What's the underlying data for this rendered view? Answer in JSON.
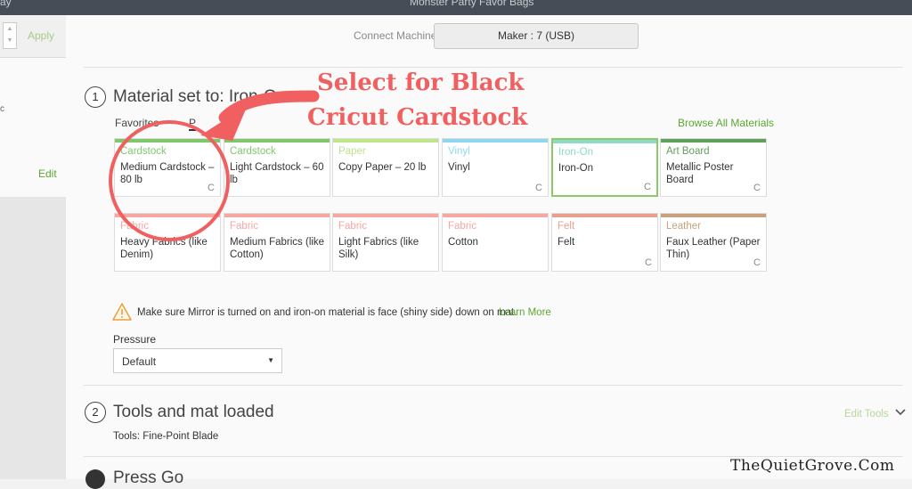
{
  "topbar": {
    "left_text": "ay",
    "center_text": "Monster Party Favor Bags"
  },
  "left_panel": {
    "apply_label": "Apply",
    "edit_label": "Edit",
    "stray_char": "c"
  },
  "header": {
    "connect_label": "Connect Machine",
    "machine": "Maker : 7 (USB)"
  },
  "step1": {
    "number": "1",
    "title": "Material set to: Iron-On",
    "tabs": [
      {
        "label": "Favorites"
      },
      {
        "label": "P"
      }
    ],
    "browse_label": "Browse All Materials",
    "materials": [
      {
        "category": "Cardstock",
        "name": "Medium Cardstock – 80 lb",
        "color": "#7ec86a",
        "badge": "C"
      },
      {
        "category": "Cardstock",
        "name": "Light Cardstock – 60 lb",
        "color": "#7ec86a",
        "badge": ""
      },
      {
        "category": "Paper",
        "name": "Copy Paper – 20 lb",
        "color": "#bfe48a",
        "badge": ""
      },
      {
        "category": "Vinyl",
        "name": "Vinyl",
        "color": "#8fd7ef",
        "badge": "C"
      },
      {
        "category": "Iron-On",
        "name": "Iron-On",
        "color": "#8ed9c8",
        "badge": "C",
        "selected": true
      },
      {
        "category": "Art Board",
        "name": "Metallic Poster Board",
        "color": "#5fa05a",
        "badge": "C"
      },
      {
        "category": "Fabric",
        "name": "Heavy Fabrics (like Denim)",
        "color": "#f5a7a0",
        "badge": ""
      },
      {
        "category": "Fabric",
        "name": "Medium Fabrics (like Cotton)",
        "color": "#f5a7a0",
        "badge": ""
      },
      {
        "category": "Fabric",
        "name": "Light Fabrics (like Silk)",
        "color": "#f5a7a0",
        "badge": ""
      },
      {
        "category": "Fabric",
        "name": "Cotton",
        "color": "#f5a7a0",
        "badge": ""
      },
      {
        "category": "Felt",
        "name": "Felt",
        "color": "#e8a08a",
        "badge": "C"
      },
      {
        "category": "Leather",
        "name": "Faux Leather (Paper Thin)",
        "color": "#c9a17a",
        "badge": "C"
      }
    ],
    "warning": "Make sure Mirror is turned on and iron-on material is face (shiny side) down on mat.",
    "learn_more": "Learn More",
    "pressure_label": "Pressure",
    "pressure_value": "Default"
  },
  "step2": {
    "number": "2",
    "title": "Tools and mat loaded",
    "subtitle": "Tools: Fine-Point Blade",
    "edit_tools": "Edit Tools"
  },
  "step3": {
    "title": "Press Go"
  },
  "annotation": {
    "line1": "Select for Black",
    "line2": "Cricut Cardstock",
    "color": "#f06060"
  },
  "watermark": "TheQuietGrove.Com"
}
